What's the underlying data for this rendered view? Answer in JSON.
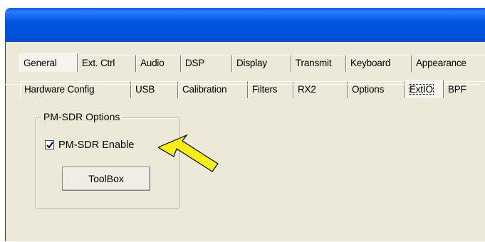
{
  "main_tabs": [
    {
      "label": "General",
      "selected": true
    },
    {
      "label": "Ext. Ctrl",
      "selected": false
    },
    {
      "label": "Audio",
      "selected": false
    },
    {
      "label": "DSP",
      "selected": false
    },
    {
      "label": "Display",
      "selected": false
    },
    {
      "label": "Transmit",
      "selected": false
    },
    {
      "label": "Keyboard",
      "selected": false
    },
    {
      "label": "Appearance",
      "selected": false
    }
  ],
  "sub_tabs": [
    {
      "label": "Hardware Config",
      "selected": false
    },
    {
      "label": "USB",
      "selected": false
    },
    {
      "label": "Calibration",
      "selected": false
    },
    {
      "label": "Filters",
      "selected": false
    },
    {
      "label": "RX2",
      "selected": false
    },
    {
      "label": "Options",
      "selected": false
    },
    {
      "label": "ExtIO",
      "selected": true
    },
    {
      "label": "BPF",
      "selected": false
    }
  ],
  "group": {
    "legend": "PM-SDR Options",
    "enable_checkbox": {
      "label": "PM-SDR Enable",
      "checked": true
    },
    "toolbox_button": "ToolBox"
  },
  "annotation": {
    "arrow_color": "#f5ee1a",
    "icon": "pointer-arrow-icon"
  },
  "colors": {
    "titlebar": "#0055e0",
    "dialog_bg": "#ece9d8"
  }
}
